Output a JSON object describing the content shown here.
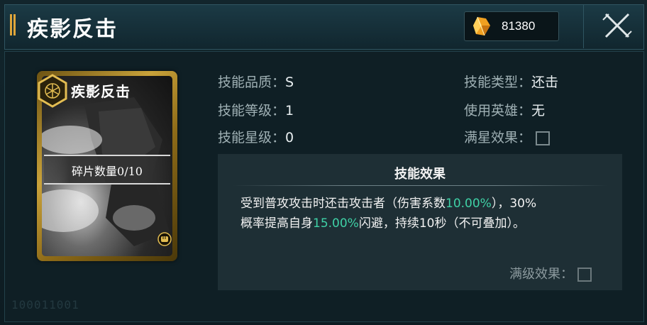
{
  "header": {
    "title": "疾影反击",
    "currency_icon": "crystal-icon",
    "currency_value": "81380",
    "close_icon": "close-icon"
  },
  "card": {
    "emblem_icon": "hexagon-emblem-icon",
    "name": "疾影反击",
    "fragments_label": "碎片数量0/10",
    "type_icon": "fist-icon",
    "frame_color": "#c9a23a"
  },
  "info": {
    "quality_label": "技能品质：",
    "quality_value": "S",
    "level_label": "技能等级：",
    "level_value": "1",
    "star_label": "技能星级：",
    "star_value": "0",
    "type_label": "技能类型：",
    "type_value": "还击",
    "hero_label": "使用英雄：",
    "hero_value": "无",
    "max_star_label": "满星效果："
  },
  "effect": {
    "title": "技能效果",
    "line1_a": "受到普攻攻击时还击攻击者（伤害系数",
    "line1_hl": "10.00%",
    "line1_b": "），30%",
    "line2_a": "概率提高自身",
    "line2_hl": "15.00%",
    "line2_b": "闪避，持续10秒（不可叠加）。",
    "highlight_color": "#3fd1a6",
    "max_level_label": "满级效果："
  },
  "watermark": "100011001"
}
